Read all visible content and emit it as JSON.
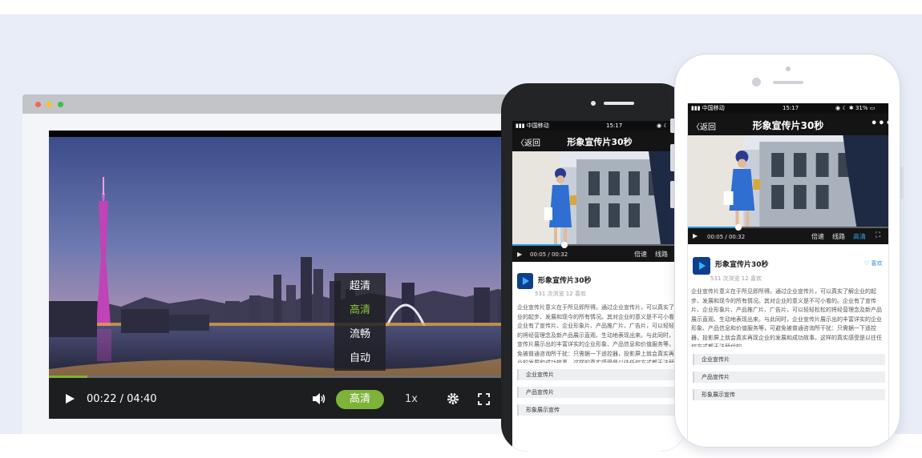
{
  "desktop_player": {
    "window_dots": [
      "close",
      "minimize",
      "maximize"
    ],
    "time": "00:22 / 04:40",
    "quality_button": "高清",
    "speed": "1x",
    "progress": 0.08,
    "accent_color": "#7eb33a",
    "icons": [
      "play-icon",
      "volume-icon",
      "gear-icon",
      "fullscreen-icon"
    ],
    "quality_menu": [
      {
        "label": "超清",
        "selected": false
      },
      {
        "label": "高清",
        "selected": true
      },
      {
        "label": "流畅",
        "selected": false
      },
      {
        "label": "自动",
        "selected": false
      }
    ]
  },
  "phone_dark": {
    "status": {
      "carrier": "中国移动",
      "time": "15:17"
    },
    "back_label": "返回",
    "title": "形象宣传片30秒",
    "player": {
      "time": "00:05 / 00:32",
      "speed": "倍速",
      "route": "线路",
      "progress": 0.3
    },
    "video_title": "形象宣传片30秒",
    "meta": "531 次浏览 12 喜欢",
    "description": "企业宣传片意义在于所见即所得。通过企业宣传片，可以真实了解企业的起步、发展和现今的所有情况。其对企业的意义是不可小看的。企业有了宣传片、企业形象片、产品推广片、广告片，可以轻轻松松的将经营理念及新产品展示直观、生动地表现出来。与此同时，企业宣传片展示出的丰富详实的企业形象、产品信息和价值服务等，可避免被普通咨询所干扰：只需据一下遥控器，投影屏上就会真实再现企业的发展和成功故事。这样的真实感受是以往任何方式都无法替代的。",
    "list": [
      "企业宣传片",
      "产品宣传片",
      "形象展示宣传"
    ]
  },
  "phone_white": {
    "status": {
      "carrier": "中国移动",
      "time": "15:17",
      "battery": "31%"
    },
    "back_label": "返回",
    "title": "形象宣传片30秒",
    "more": "•••",
    "player": {
      "time": "00:05 / 00:32",
      "speed": "倍速",
      "route": "线路",
      "quality": "高清",
      "progress": 0.25
    },
    "video_title": "形象宣传片30秒",
    "like_label": "喜欢",
    "meta": "531 次浏览 12 喜欢",
    "description": "企业宣传片意义在于所见即所得。通过企业宣传片，可以真实了解企业的起步、发展和现今的所有情况。其对企业的意义是不可小看的。企业有了宣传片、企业形象片、产品推广片、广告片，可以轻轻松松的将经营理念及新产品展示直观、生动地表现出来。与此同时，企业宣传片展示出的丰富详实的企业形象、产品信息和价值服务等，可避免被普通咨询所干扰：只需据一下遥控器，投影屏上就会真实再现企业的发展和成功故事。这样的真实感受是以往任何方式都无法替代的。",
    "list": [
      "企业宣传片",
      "产品宣传片",
      "形象展示宣传"
    ],
    "accent_color": "#2b86e2"
  }
}
